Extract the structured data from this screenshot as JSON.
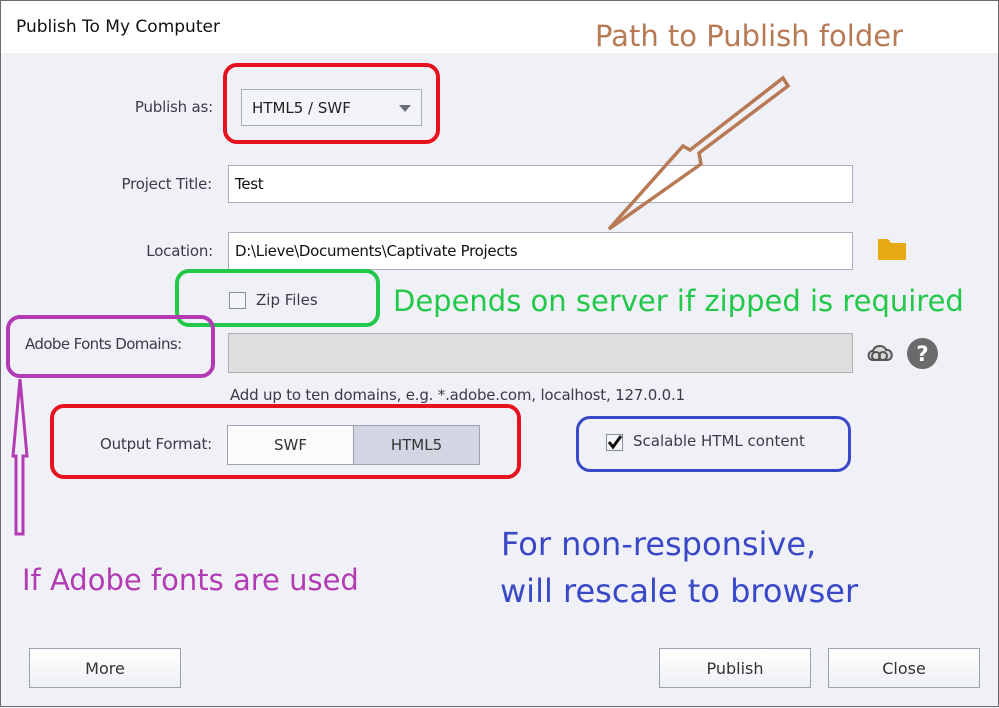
{
  "window": {
    "title": "Publish To My Computer"
  },
  "form": {
    "publish_as": {
      "label": "Publish as:",
      "value": "HTML5 / SWF"
    },
    "project_title": {
      "label": "Project Title:",
      "value": "Test"
    },
    "location": {
      "label": "Location:",
      "value": "D:\\Lieve\\Documents\\Captivate Projects",
      "browse_icon": "folder-icon"
    },
    "zip_files": {
      "label": "Zip Files",
      "checked": false
    },
    "adobe_fonts_domains": {
      "label": "Adobe Fonts Domains:",
      "value": "",
      "hint": "Add up to ten domains, e.g. *.adobe.com, localhost, 127.0.0.1",
      "icons": [
        "creative-cloud-icon",
        "help-icon"
      ]
    },
    "output_format": {
      "label": "Output Format:",
      "options": [
        "SWF",
        "HTML5"
      ],
      "selected": "HTML5"
    },
    "scalable_html": {
      "label": "Scalable HTML content",
      "checked": true
    }
  },
  "buttons": {
    "more": "More",
    "publish": "Publish",
    "close": "Close"
  },
  "annotations": {
    "path_note": {
      "text": "Path to Publish folder",
      "color": "#b87a55"
    },
    "zip_note": {
      "text": "Depends on server if zipped is required",
      "color": "#22c84a"
    },
    "fonts_note": {
      "text": "If Adobe fonts are used",
      "color": "#b23bb4"
    },
    "scalable_note_line1": {
      "text": "For non-responsive,",
      "color": "#3a48c8"
    },
    "scalable_note_line2": {
      "text": "will rescale to browser",
      "color": "#3a48c8"
    },
    "publish_as_outline_color": "#e8121e",
    "output_format_outline_color": "#e8121e",
    "zip_outline_color": "#22c84a",
    "fonts_outline_color": "#b23bb4",
    "scalable_outline_color": "#3a48c8"
  }
}
